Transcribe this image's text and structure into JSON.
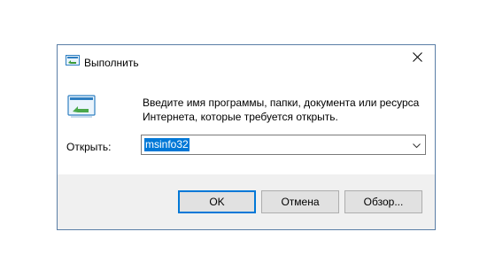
{
  "window": {
    "title": "Выполнить",
    "close_icon": "close-icon"
  },
  "main": {
    "description": "Введите имя программы, папки, документа или ресурса Интернета, которые требуется открыть.",
    "open_label": "Открыть:",
    "open_value": "msinfo32"
  },
  "buttons": {
    "ok": "OK",
    "cancel": "Отмена",
    "browse": "Обзор..."
  },
  "colors": {
    "accent": "#0078d7",
    "footer_bg": "#f0f0f0",
    "border": "#5a7ea6"
  },
  "icons": {
    "title": "run-icon",
    "big": "run-large-icon",
    "dropdown": "chevron-down-icon"
  }
}
